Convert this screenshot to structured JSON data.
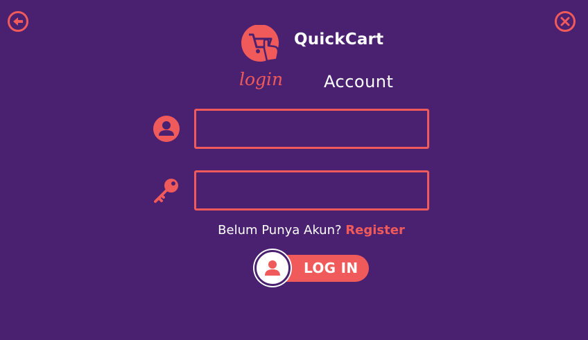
{
  "header": {
    "app_title": "QuickCart",
    "back_icon": "arrow-left-icon",
    "close_icon": "close-icon",
    "logo_icon": "shopping-cart-icon"
  },
  "tabs": {
    "login_label": "login",
    "account_label": "Account",
    "active": "login"
  },
  "form": {
    "username_icon": "user-icon",
    "username_value": "",
    "password_icon": "key-icon",
    "password_value": "",
    "register_prompt": "Belum Punya Akun?",
    "register_link": "Register",
    "login_button_label": "LOG IN",
    "login_button_icon": "user-icon"
  },
  "colors": {
    "background": "#4a2070",
    "accent": "#f15a5a",
    "text": "#ffffff"
  }
}
